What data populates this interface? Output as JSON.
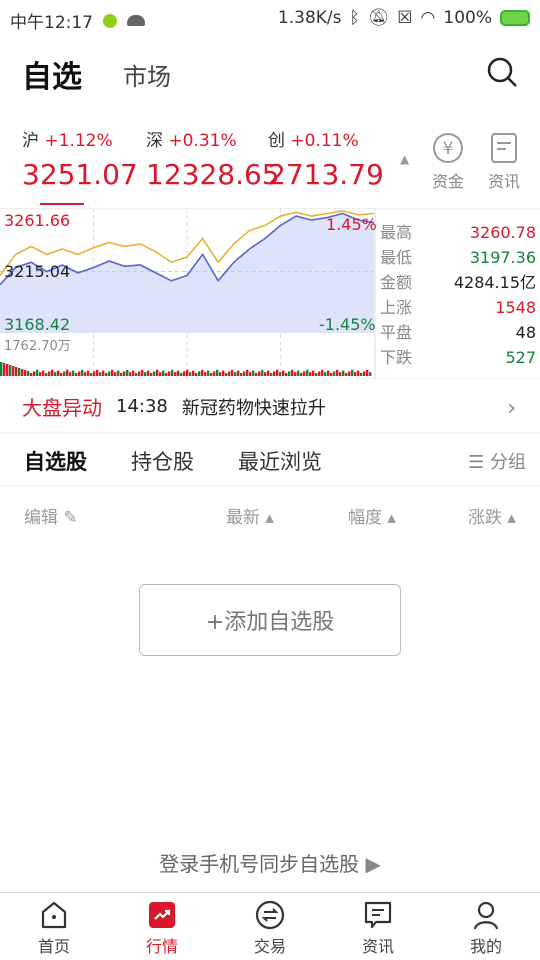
{
  "status": {
    "time": "中午12:17",
    "speed": "1.38K/s",
    "battery": "100%"
  },
  "header": {
    "tab_active": "自选",
    "tab_other": "市场"
  },
  "indices": [
    {
      "name": "沪",
      "change": "+1.12%",
      "value": "3251.07"
    },
    {
      "name": "深",
      "change": "+0.31%",
      "value": "12328.65"
    },
    {
      "name": "创",
      "change": "+0.11%",
      "value": "2713.79"
    }
  ],
  "side_buttons": [
    {
      "label": "资金",
      "icon": "yuan-icon"
    },
    {
      "label": "资讯",
      "icon": "document-icon"
    }
  ],
  "chart": {
    "high_label": "3261.66",
    "mid_label": "3215.04",
    "low_label": "3168.42",
    "pct_up": "1.45%",
    "pct_down": "-1.45%",
    "volume_label": "1762.70万"
  },
  "chart_data": {
    "type": "line",
    "ylim": [
      3168.42,
      3261.66
    ],
    "blue_prices": [
      3205,
      3218,
      3222,
      3215,
      3220,
      3214,
      3218,
      3223,
      3219,
      3220,
      3214,
      3208,
      3212,
      3228,
      3208,
      3222,
      3232,
      3240,
      3250,
      3257,
      3254,
      3256,
      3259,
      3254,
      3252
    ],
    "yellow_prices": [
      3212,
      3228,
      3234,
      3228,
      3232,
      3228,
      3233,
      3237,
      3234,
      3236,
      3230,
      3222,
      3226,
      3240,
      3222,
      3236,
      3246,
      3250,
      3257,
      3260,
      3257,
      3259,
      3261,
      3258,
      3259
    ]
  },
  "stats": [
    {
      "k": "最高",
      "v": "3260.78",
      "c": "red"
    },
    {
      "k": "最低",
      "v": "3197.36",
      "c": "green"
    },
    {
      "k": "金额",
      "v": "4284.15亿",
      "c": ""
    },
    {
      "k": "上涨",
      "v": "1548",
      "c": "red"
    },
    {
      "k": "平盘",
      "v": "48",
      "c": ""
    },
    {
      "k": "下跌",
      "v": "527",
      "c": "green"
    }
  ],
  "news": {
    "tag": "大盘异动",
    "time": "14:38",
    "text": "新冠药物快速拉升"
  },
  "tabs": [
    "自选股",
    "持仓股",
    "最近浏览"
  ],
  "group_label": "分组",
  "columns": {
    "edit": "编辑",
    "latest": "最新 ▴",
    "range": "幅度 ▴",
    "change": "涨跌 ▴"
  },
  "add_button": "+添加自选股",
  "login_text": "登录手机号同步自选股",
  "nav": [
    "首页",
    "行情",
    "交易",
    "资讯",
    "我的"
  ],
  "colors": {
    "red": "#d9192b",
    "green": "#14833b",
    "blue_line": "#5566cc",
    "yellow_line": "#e8b230",
    "fill": "#dfe3fa"
  }
}
